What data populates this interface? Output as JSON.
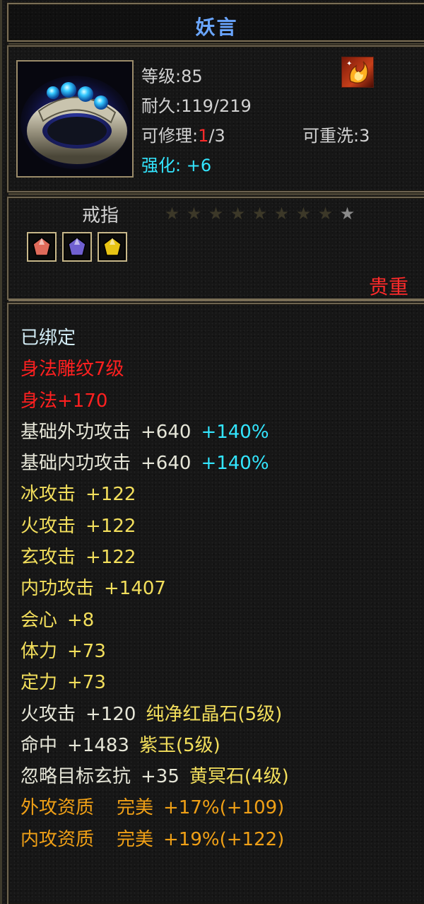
{
  "item": {
    "name": "妖言",
    "level": "等级:85",
    "durability": "耐久:119/219",
    "repair_label": "可修理:",
    "repair_used": "1",
    "repair_total": "/3",
    "rewash": "可重洗:3",
    "refine_label": "强化:",
    "refine_value": "+6",
    "type": "戒指",
    "stars_total": 9,
    "stars_lit": 1,
    "rarity": "贵重"
  },
  "gems": [
    {
      "name": "red-gem-icon",
      "color": "#e06a5a"
    },
    {
      "name": "purple-gem-icon",
      "color": "#7060d0"
    },
    {
      "name": "yellow-gem-icon",
      "color": "#e8c414"
    }
  ],
  "stats": [
    {
      "label": "已绑定",
      "value": "",
      "extra": "",
      "style": "bound"
    },
    {
      "label": "身法雕纹7级",
      "value": "",
      "extra": "",
      "style": "red"
    },
    {
      "label": "身法",
      "value": "+170",
      "extra": "",
      "style": "red-tight"
    },
    {
      "label": "基础外功攻击",
      "value": "+640",
      "extra": "+140%",
      "style": "white-cyan"
    },
    {
      "label": "基础内功攻击",
      "value": "+640",
      "extra": "+140%",
      "style": "white-cyan"
    },
    {
      "label": "冰攻击",
      "value": "+122",
      "extra": "",
      "style": "yellow"
    },
    {
      "label": "火攻击",
      "value": "+122",
      "extra": "",
      "style": "yellow"
    },
    {
      "label": "玄攻击",
      "value": "+122",
      "extra": "",
      "style": "yellow"
    },
    {
      "label": "内功攻击",
      "value": "+1407",
      "extra": "",
      "style": "yellow"
    },
    {
      "label": "会心",
      "value": "+8",
      "extra": "",
      "style": "yellow"
    },
    {
      "label": "体力",
      "value": "+73",
      "extra": "",
      "style": "yellow"
    },
    {
      "label": "定力",
      "value": "+73",
      "extra": "",
      "style": "yellow"
    },
    {
      "label": "火攻击",
      "value": "+120",
      "extra": "纯净红晶石(5级)",
      "style": "white-yellow"
    },
    {
      "label": "命中",
      "value": "+1483",
      "extra": "紫玉(5级)",
      "style": "white-yellow"
    },
    {
      "label": "忽略目标玄抗",
      "value": "+35",
      "extra": "黄冥石(4级)",
      "style": "white-yellow"
    },
    {
      "label": "外攻资质",
      "value": "完美",
      "extra": "+17%(+109)",
      "style": "orange"
    },
    {
      "label": "内攻资质",
      "value": "完美",
      "extra": "+19%(+122)",
      "style": "orange"
    }
  ]
}
